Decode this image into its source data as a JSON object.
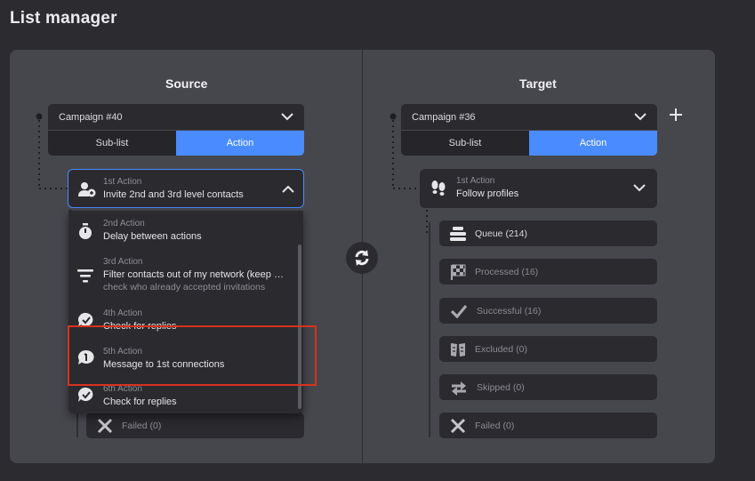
{
  "page": {
    "title": "List manager"
  },
  "source": {
    "title": "Source",
    "campaign": "Campaign #40",
    "tabs": [
      "Sub-list",
      "Action"
    ],
    "selected_action": {
      "meta": "1st Action",
      "desc": "Invite 2nd and 3rd level contacts"
    },
    "dropdown": [
      {
        "meta": "2nd Action",
        "desc": "Delay between actions",
        "icon": "stopwatch-icon"
      },
      {
        "meta": "3rd Action",
        "desc": "Filter contacts out of my network (keep …",
        "desc2": "check who already accepted invitations",
        "icon": "filter-icon"
      },
      {
        "meta": "4th Action",
        "desc": "Check for replies",
        "icon": "chat-check-icon"
      },
      {
        "meta": "5th Action",
        "desc": "Message to 1st connections",
        "icon": "message-icon"
      },
      {
        "meta": "6th Action",
        "desc": "Check for replies",
        "icon": "chat-check-icon"
      }
    ],
    "failed_label": "Failed (0)"
  },
  "target": {
    "title": "Target",
    "campaign": "Campaign #36",
    "tabs": [
      "Sub-list",
      "Action"
    ],
    "selected_action": {
      "meta": "1st Action",
      "desc": "Follow profiles"
    },
    "statuses": [
      {
        "label": "Queue (214)",
        "icon": "queue-icon",
        "dim": false
      },
      {
        "label": "Processed (16)",
        "icon": "checkered-flag-icon",
        "dim": true
      },
      {
        "label": "Successful (16)",
        "icon": "checkmark-icon",
        "dim": true
      },
      {
        "label": "Excluded (0)",
        "icon": "excluded-icon",
        "dim": true
      },
      {
        "label": "Skipped (0)",
        "icon": "skip-arrows-icon",
        "dim": true
      },
      {
        "label": "Failed (0)",
        "icon": "x-icon",
        "dim": true
      }
    ]
  },
  "colors": {
    "accent": "#4a8cff",
    "highlight": "#d8331f",
    "panel": "#46464d",
    "card": "#2a2a2f"
  }
}
